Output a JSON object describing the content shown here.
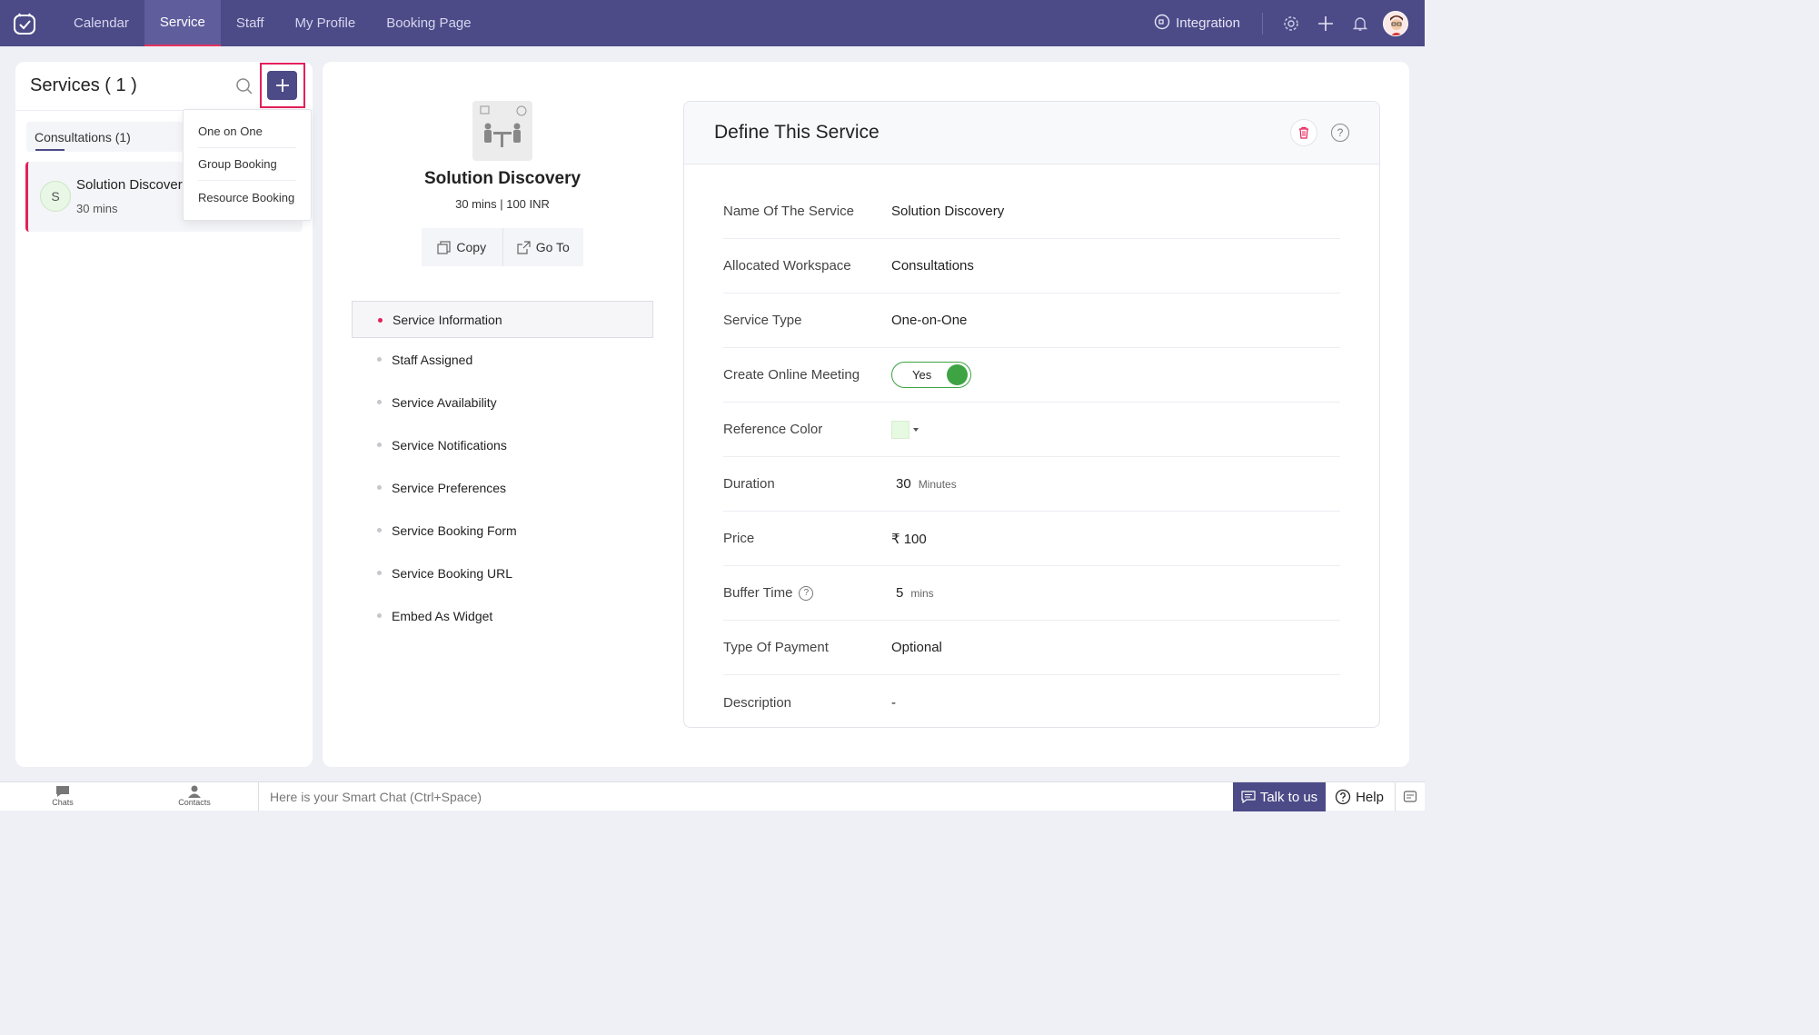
{
  "nav": {
    "tabs": [
      {
        "label": "Calendar"
      },
      {
        "label": "Service"
      },
      {
        "label": "Staff"
      },
      {
        "label": "My Profile"
      },
      {
        "label": "Booking Page"
      }
    ],
    "active_tab": "Service",
    "integration_label": "Integration"
  },
  "left_panel": {
    "title": "Services ( 1 )",
    "workspace_tab": "Consultations (1)",
    "service": {
      "avatar_letter": "S",
      "name": "Solution Discovery",
      "duration": "30 mins"
    },
    "add_menu": [
      "One on One",
      "Group Booking",
      "Resource Booking"
    ]
  },
  "service_summary": {
    "name": "Solution Discovery",
    "sub": "30 mins | 100 INR",
    "copy_label": "Copy",
    "goto_label": "Go To"
  },
  "side_menu": [
    {
      "label": "Service Information",
      "active": true
    },
    {
      "label": "Staff Assigned"
    },
    {
      "label": "Service Availability"
    },
    {
      "label": "Service Notifications"
    },
    {
      "label": "Service Preferences"
    },
    {
      "label": "Service Booking Form"
    },
    {
      "label": "Service Booking URL"
    },
    {
      "label": "Embed As Widget"
    }
  ],
  "define": {
    "title": "Define This Service",
    "help_glyph": "?",
    "fields": {
      "name": {
        "label": "Name Of The Service",
        "value": "Solution Discovery"
      },
      "workspace": {
        "label": "Allocated Workspace",
        "value": "Consultations"
      },
      "type": {
        "label": "Service Type",
        "value": "One-on-One"
      },
      "online": {
        "label": "Create Online Meeting",
        "value": "Yes"
      },
      "color": {
        "label": "Reference Color",
        "value": "#e6fae2"
      },
      "duration": {
        "label": "Duration",
        "value": "30",
        "unit": "Minutes"
      },
      "price": {
        "label": "Price",
        "value": "₹ 100"
      },
      "buffer": {
        "label": "Buffer Time",
        "value": "5",
        "unit": "mins",
        "help_glyph": "?"
      },
      "payment": {
        "label": "Type Of Payment",
        "value": "Optional"
      },
      "description": {
        "label": "Description",
        "value": "-"
      }
    }
  },
  "bottom": {
    "chats": "Chats",
    "contacts": "Contacts",
    "chat_placeholder": "Here is your Smart Chat (Ctrl+Space)",
    "talk": "Talk to us",
    "help": "Help"
  },
  "colors": {
    "brand": "#4c4a87",
    "accent": "#e3205a",
    "toggle_green": "#3ea343"
  }
}
